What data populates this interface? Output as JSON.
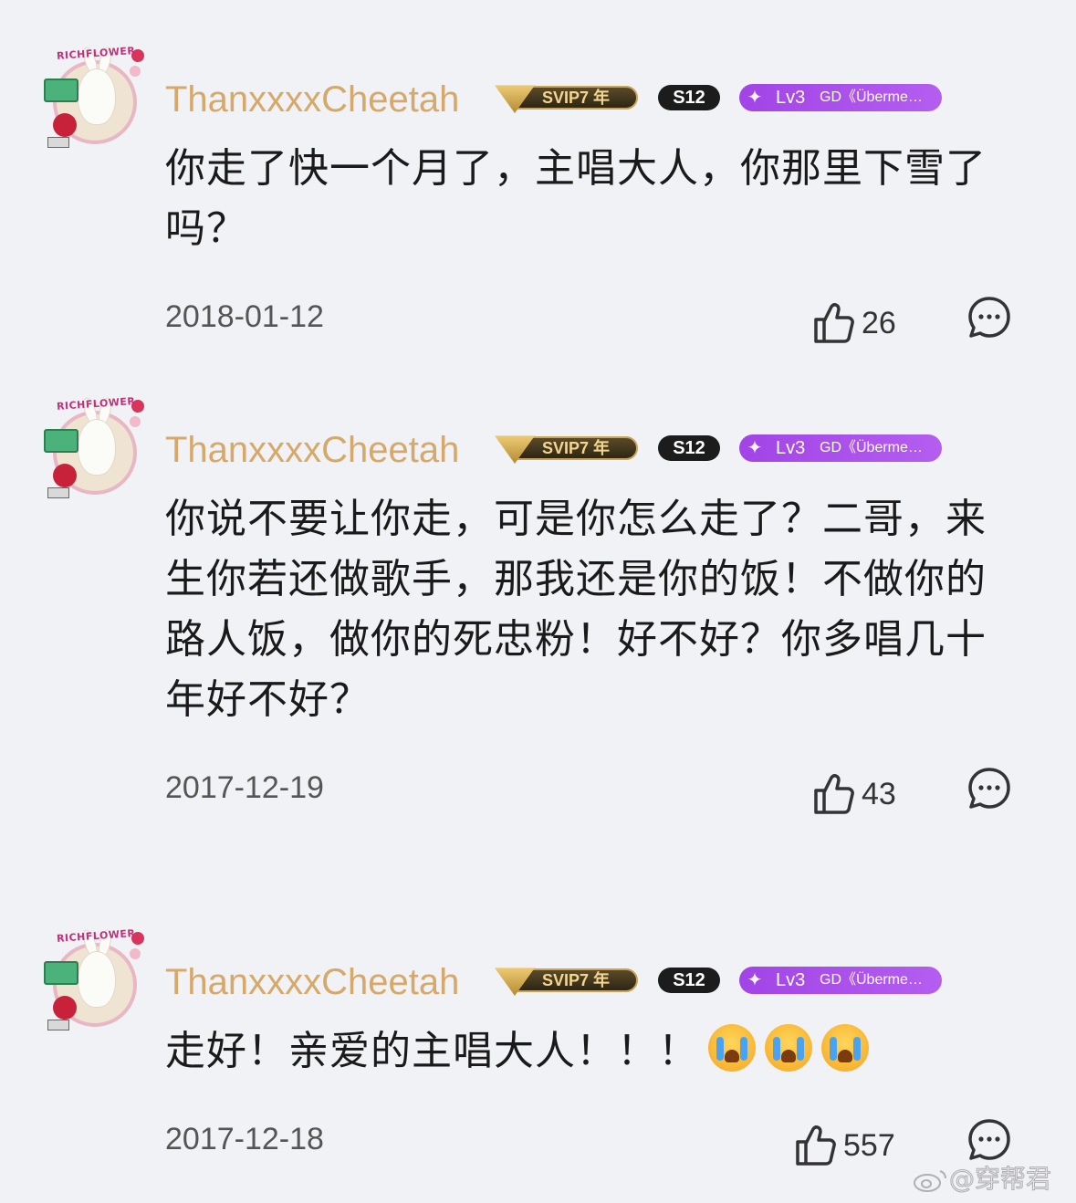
{
  "comments": [
    {
      "username": "ThanxxxxCheetah",
      "svip_label": "SVIP7 年",
      "s12_label": "S12",
      "level_label": "Lv3",
      "level_title": "GD《Überme…",
      "avatar_text": "RICHFLOWER",
      "text": "你走了快一个月了，主唱大人，你那里下雪了吗？",
      "date": "2018-01-12",
      "likes": "26"
    },
    {
      "username": "ThanxxxxCheetah",
      "svip_label": "SVIP7 年",
      "s12_label": "S12",
      "level_label": "Lv3",
      "level_title": "GD《Überme…",
      "avatar_text": "RICHFLOWER",
      "text": "你说不要让你走，可是你怎么走了？二哥，来生你若还做歌手，那我还是你的饭！不做你的路人饭，做你的死忠粉！好不好？你多唱几十年好不好？",
      "date": "2017-12-19",
      "likes": "43"
    },
    {
      "username": "ThanxxxxCheetah",
      "svip_label": "SVIP7 年",
      "s12_label": "S12",
      "level_label": "Lv3",
      "level_title": "GD《Überme…",
      "avatar_text": "RICHFLOWER",
      "text": "走好！亲爱的主唱大人！！！",
      "emoji": [
        "loudly-crying-face",
        "loudly-crying-face",
        "loudly-crying-face"
      ],
      "date": "2017-12-18",
      "likes": "557"
    }
  ],
  "watermark": "@穿帮君",
  "colors": {
    "background": "#f1f2f6",
    "username": "#d6a86a",
    "level_badge": "#a244e6",
    "svip_gold": "#c9a35a"
  }
}
